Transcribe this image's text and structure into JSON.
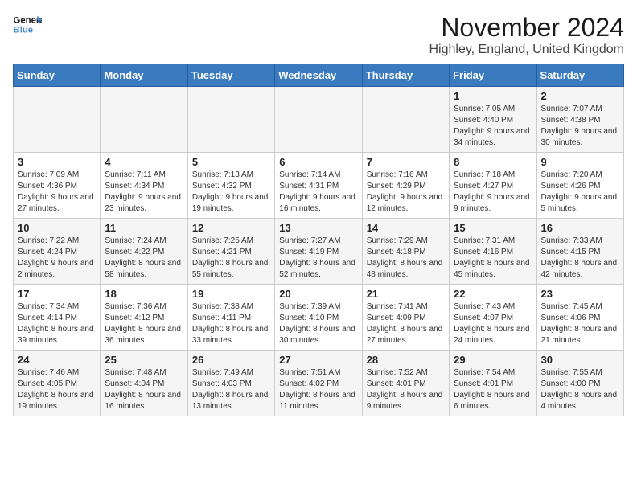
{
  "header": {
    "logo_line1": "General",
    "logo_line2": "Blue",
    "month": "November 2024",
    "location": "Highley, England, United Kingdom"
  },
  "days_of_week": [
    "Sunday",
    "Monday",
    "Tuesday",
    "Wednesday",
    "Thursday",
    "Friday",
    "Saturday"
  ],
  "weeks": [
    [
      {
        "day": "",
        "info": ""
      },
      {
        "day": "",
        "info": ""
      },
      {
        "day": "",
        "info": ""
      },
      {
        "day": "",
        "info": ""
      },
      {
        "day": "",
        "info": ""
      },
      {
        "day": "1",
        "info": "Sunrise: 7:05 AM\nSunset: 4:40 PM\nDaylight: 9 hours and 34 minutes."
      },
      {
        "day": "2",
        "info": "Sunrise: 7:07 AM\nSunset: 4:38 PM\nDaylight: 9 hours and 30 minutes."
      }
    ],
    [
      {
        "day": "3",
        "info": "Sunrise: 7:09 AM\nSunset: 4:36 PM\nDaylight: 9 hours and 27 minutes."
      },
      {
        "day": "4",
        "info": "Sunrise: 7:11 AM\nSunset: 4:34 PM\nDaylight: 9 hours and 23 minutes."
      },
      {
        "day": "5",
        "info": "Sunrise: 7:13 AM\nSunset: 4:32 PM\nDaylight: 9 hours and 19 minutes."
      },
      {
        "day": "6",
        "info": "Sunrise: 7:14 AM\nSunset: 4:31 PM\nDaylight: 9 hours and 16 minutes."
      },
      {
        "day": "7",
        "info": "Sunrise: 7:16 AM\nSunset: 4:29 PM\nDaylight: 9 hours and 12 minutes."
      },
      {
        "day": "8",
        "info": "Sunrise: 7:18 AM\nSunset: 4:27 PM\nDaylight: 9 hours and 9 minutes."
      },
      {
        "day": "9",
        "info": "Sunrise: 7:20 AM\nSunset: 4:26 PM\nDaylight: 9 hours and 5 minutes."
      }
    ],
    [
      {
        "day": "10",
        "info": "Sunrise: 7:22 AM\nSunset: 4:24 PM\nDaylight: 9 hours and 2 minutes."
      },
      {
        "day": "11",
        "info": "Sunrise: 7:24 AM\nSunset: 4:22 PM\nDaylight: 8 hours and 58 minutes."
      },
      {
        "day": "12",
        "info": "Sunrise: 7:25 AM\nSunset: 4:21 PM\nDaylight: 8 hours and 55 minutes."
      },
      {
        "day": "13",
        "info": "Sunrise: 7:27 AM\nSunset: 4:19 PM\nDaylight: 8 hours and 52 minutes."
      },
      {
        "day": "14",
        "info": "Sunrise: 7:29 AM\nSunset: 4:18 PM\nDaylight: 8 hours and 48 minutes."
      },
      {
        "day": "15",
        "info": "Sunrise: 7:31 AM\nSunset: 4:16 PM\nDaylight: 8 hours and 45 minutes."
      },
      {
        "day": "16",
        "info": "Sunrise: 7:33 AM\nSunset: 4:15 PM\nDaylight: 8 hours and 42 minutes."
      }
    ],
    [
      {
        "day": "17",
        "info": "Sunrise: 7:34 AM\nSunset: 4:14 PM\nDaylight: 8 hours and 39 minutes."
      },
      {
        "day": "18",
        "info": "Sunrise: 7:36 AM\nSunset: 4:12 PM\nDaylight: 8 hours and 36 minutes."
      },
      {
        "day": "19",
        "info": "Sunrise: 7:38 AM\nSunset: 4:11 PM\nDaylight: 8 hours and 33 minutes."
      },
      {
        "day": "20",
        "info": "Sunrise: 7:39 AM\nSunset: 4:10 PM\nDaylight: 8 hours and 30 minutes."
      },
      {
        "day": "21",
        "info": "Sunrise: 7:41 AM\nSunset: 4:09 PM\nDaylight: 8 hours and 27 minutes."
      },
      {
        "day": "22",
        "info": "Sunrise: 7:43 AM\nSunset: 4:07 PM\nDaylight: 8 hours and 24 minutes."
      },
      {
        "day": "23",
        "info": "Sunrise: 7:45 AM\nSunset: 4:06 PM\nDaylight: 8 hours and 21 minutes."
      }
    ],
    [
      {
        "day": "24",
        "info": "Sunrise: 7:46 AM\nSunset: 4:05 PM\nDaylight: 8 hours and 19 minutes."
      },
      {
        "day": "25",
        "info": "Sunrise: 7:48 AM\nSunset: 4:04 PM\nDaylight: 8 hours and 16 minutes."
      },
      {
        "day": "26",
        "info": "Sunrise: 7:49 AM\nSunset: 4:03 PM\nDaylight: 8 hours and 13 minutes."
      },
      {
        "day": "27",
        "info": "Sunrise: 7:51 AM\nSunset: 4:02 PM\nDaylight: 8 hours and 11 minutes."
      },
      {
        "day": "28",
        "info": "Sunrise: 7:52 AM\nSunset: 4:01 PM\nDaylight: 8 hours and 9 minutes."
      },
      {
        "day": "29",
        "info": "Sunrise: 7:54 AM\nSunset: 4:01 PM\nDaylight: 8 hours and 6 minutes."
      },
      {
        "day": "30",
        "info": "Sunrise: 7:55 AM\nSunset: 4:00 PM\nDaylight: 8 hours and 4 minutes."
      }
    ]
  ]
}
